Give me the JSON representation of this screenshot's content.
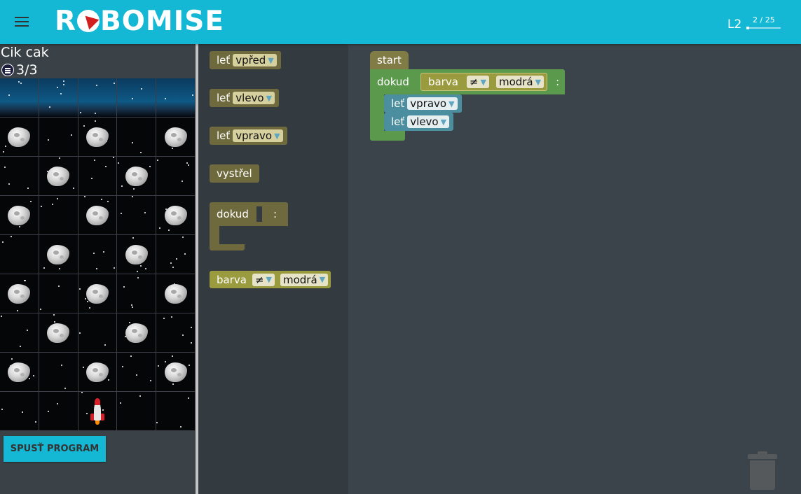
{
  "header": {
    "brand": "ROBOMISE",
    "level_label": "L2",
    "progress_text": "2 / 25",
    "progress_fraction": 0.08
  },
  "game": {
    "level_title": "Cik cak",
    "counter": "3/3",
    "run_button_label": "SPUSŤ PROGRAM"
  },
  "toolbox": {
    "fly_label": "leť",
    "fly_forward_option": "vpřed",
    "fly_left_option": "vlevo",
    "fly_right_option": "vpravo",
    "shoot_label": "vystřel",
    "while_label": "dokud",
    "while_colon": ":",
    "cond_color_label": "barva",
    "cond_operator": "≠",
    "cond_value": "modrá"
  },
  "workspace": {
    "start_label": "start",
    "while_label": "dokud",
    "while_colon": ":",
    "cond_color_label": "barva",
    "cond_operator": "≠",
    "cond_value": "modrá",
    "fly1_label": "leť",
    "fly1_option": "vpravo",
    "fly2_label": "leť",
    "fly2_option": "vlevo"
  },
  "colors": {
    "topbar": "#15b8d4",
    "block_khaki": "#817b46",
    "block_green": "#5b9a4c",
    "block_teal": "#4a8ea0",
    "block_olive": "#9a9a3e"
  }
}
